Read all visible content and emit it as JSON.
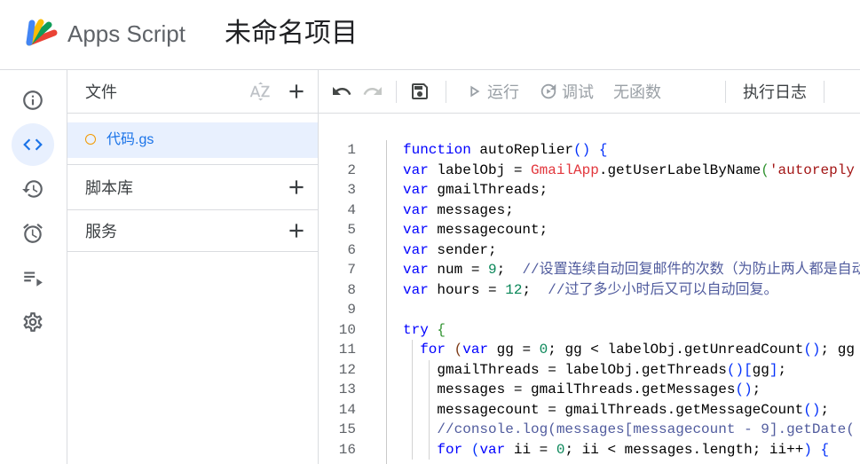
{
  "header": {
    "app_name": "Apps Script",
    "project_title": "未命名项目",
    "logo_icon": "apps-script-logo"
  },
  "nav_rail": {
    "items": [
      {
        "icon": "info-icon",
        "active": false
      },
      {
        "icon": "code-icon",
        "active": true
      },
      {
        "icon": "history-icon",
        "active": false
      },
      {
        "icon": "alarm-icon",
        "active": false
      },
      {
        "icon": "executions-icon",
        "active": false
      },
      {
        "icon": "settings-icon",
        "active": false
      }
    ]
  },
  "files_panel": {
    "title": "文件",
    "sort_icon": "sort-az-icon",
    "add_icon": "plus-icon",
    "files": [
      {
        "name": "代码.gs",
        "selected": true,
        "status_icon": "file-status-dot-icon"
      }
    ],
    "sections": [
      {
        "title": "脚本库",
        "add_icon": "plus-icon"
      },
      {
        "title": "服务",
        "add_icon": "plus-icon"
      }
    ]
  },
  "toolbar": {
    "undo_icon": "undo-icon",
    "redo_icon": "redo-icon",
    "save_icon": "save-icon",
    "run_icon": "play-icon",
    "run_label": "运行",
    "debug_icon": "debug-icon",
    "debug_label": "调试",
    "function_select_value": "无函数",
    "execution_log_label": "执行日志"
  },
  "editor": {
    "lines": [
      {
        "n": 1,
        "tokens": [
          [
            "k",
            "function"
          ],
          [
            "p",
            " autoReplier"
          ],
          [
            "b1",
            "()"
          ],
          [
            "p",
            " "
          ],
          [
            "b1",
            "{"
          ]
        ]
      },
      {
        "n": 2,
        "tokens": [
          [
            "k",
            "var"
          ],
          [
            "p",
            " labelObj = "
          ],
          [
            "g",
            "GmailApp"
          ],
          [
            "p",
            ".getUserLabelByName"
          ],
          [
            "b2",
            "("
          ],
          [
            "s",
            "'autoreply"
          ]
        ]
      },
      {
        "n": 3,
        "tokens": [
          [
            "k",
            "var"
          ],
          [
            "p",
            " gmailThreads;"
          ]
        ]
      },
      {
        "n": 4,
        "tokens": [
          [
            "k",
            "var"
          ],
          [
            "p",
            " messages;"
          ]
        ]
      },
      {
        "n": 5,
        "tokens": [
          [
            "k",
            "var"
          ],
          [
            "p",
            " messagecount;"
          ]
        ]
      },
      {
        "n": 6,
        "tokens": [
          [
            "k",
            "var"
          ],
          [
            "p",
            " sender;"
          ]
        ]
      },
      {
        "n": 7,
        "tokens": [
          [
            "k",
            "var"
          ],
          [
            "p",
            " num = "
          ],
          [
            "n",
            "9"
          ],
          [
            "p",
            ";  "
          ],
          [
            "c",
            "//设置连续自动回复邮件的次数（为防止两人都是自动"
          ]
        ]
      },
      {
        "n": 8,
        "tokens": [
          [
            "k",
            "var"
          ],
          [
            "p",
            " hours = "
          ],
          [
            "n",
            "12"
          ],
          [
            "p",
            ";  "
          ],
          [
            "c",
            "//过了多少小时后又可以自动回复。"
          ]
        ]
      },
      {
        "n": 9,
        "tokens": []
      },
      {
        "n": 10,
        "tokens": [
          [
            "k",
            "try"
          ],
          [
            "p",
            " "
          ],
          [
            "b2",
            "{"
          ]
        ]
      },
      {
        "n": 11,
        "tokens": [
          [
            "p",
            "  "
          ],
          [
            "k",
            "for"
          ],
          [
            "p",
            " "
          ],
          [
            "b3",
            "("
          ],
          [
            "k",
            "var"
          ],
          [
            "p",
            " gg = "
          ],
          [
            "n",
            "0"
          ],
          [
            "p",
            "; gg < labelObj.getUnreadCount"
          ],
          [
            "b1",
            "()"
          ],
          [
            "p",
            "; gg"
          ]
        ]
      },
      {
        "n": 12,
        "tokens": [
          [
            "p",
            "    gmailThreads = labelObj.getThreads"
          ],
          [
            "b1",
            "()"
          ],
          [
            "b1",
            "["
          ],
          [
            "p",
            "gg"
          ],
          [
            "b1",
            "]"
          ],
          [
            "p",
            ";"
          ]
        ]
      },
      {
        "n": 13,
        "tokens": [
          [
            "p",
            "    messages = gmailThreads.getMessages"
          ],
          [
            "b1",
            "()"
          ],
          [
            "p",
            ";"
          ]
        ]
      },
      {
        "n": 14,
        "tokens": [
          [
            "p",
            "    messagecount = gmailThreads.getMessageCount"
          ],
          [
            "b1",
            "()"
          ],
          [
            "p",
            ";"
          ]
        ]
      },
      {
        "n": 15,
        "tokens": [
          [
            "p",
            "    "
          ],
          [
            "c",
            "//console.log(messages[messagecount - 9].getDate("
          ]
        ]
      },
      {
        "n": 16,
        "tokens": [
          [
            "p",
            "    "
          ],
          [
            "k",
            "for"
          ],
          [
            "p",
            " "
          ],
          [
            "b1",
            "("
          ],
          [
            "k",
            "var"
          ],
          [
            "p",
            " ii = "
          ],
          [
            "n",
            "0"
          ],
          [
            "p",
            "; ii < messages.length; ii++"
          ],
          [
            "b1",
            ")"
          ],
          [
            "p",
            " "
          ],
          [
            "b1",
            "{"
          ]
        ]
      }
    ]
  },
  "colors": {
    "accent": "#1a73e8",
    "selected_bg": "#e8f0fe",
    "file_status": "#f29900",
    "disabled_text": "#9aa0a6",
    "keyword": "#0000ff",
    "global_object": "#e2363c",
    "string": "#a31515",
    "number": "#098658",
    "comment": "#515c9e",
    "bracket_1": "#0431fa",
    "bracket_2": "#319331",
    "bracket_3": "#7b3814"
  }
}
